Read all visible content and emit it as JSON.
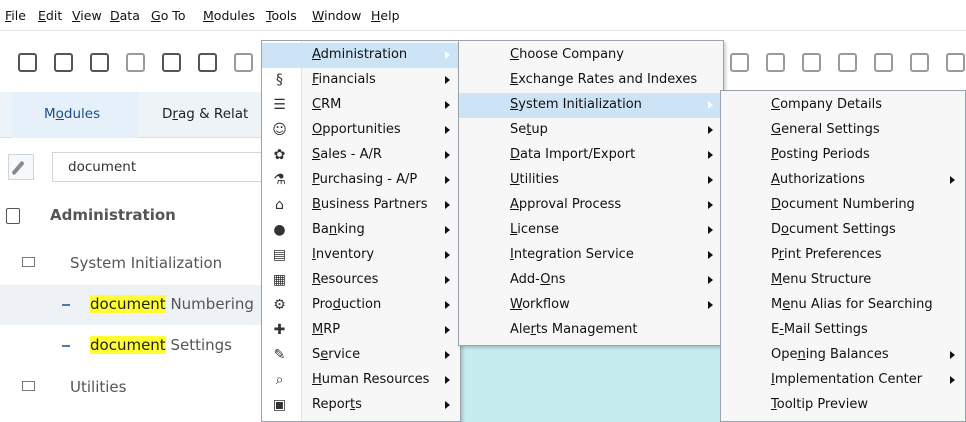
{
  "menubar": {
    "items": [
      {
        "pre": "",
        "u": "F",
        "post": "ile"
      },
      {
        "pre": "",
        "u": "E",
        "post": "dit"
      },
      {
        "pre": "",
        "u": "V",
        "post": "iew"
      },
      {
        "pre": "",
        "u": "D",
        "post": "ata"
      },
      {
        "pre": "",
        "u": "G",
        "post": "o To"
      },
      {
        "pre": "",
        "u": "M",
        "post": "odules"
      },
      {
        "pre": "",
        "u": "T",
        "post": "ools"
      },
      {
        "pre": "",
        "u": "W",
        "post": "indow"
      },
      {
        "pre": "",
        "u": "H",
        "post": "elp"
      }
    ]
  },
  "left_tabs": {
    "modules": {
      "pre": "M",
      "u": "o",
      "post": "dules"
    },
    "drag": {
      "pre": "D",
      "u": "r",
      "post": "ag & Relat"
    }
  },
  "search": {
    "value": "document"
  },
  "tree": {
    "administration": "Administration",
    "system_initialization": "System Initialization",
    "doc_numbering_match": "document",
    "doc_numbering_rest": " Numbering",
    "doc_settings_match": "document",
    "doc_settings_rest": " Settings",
    "utilities": "Utilities"
  },
  "modules_menu": [
    {
      "pre": "",
      "u": "A",
      "post": "dministration",
      "icon": "administration-icon",
      "selected": true
    },
    {
      "pre": "",
      "u": "F",
      "post": "inancials",
      "icon": "financials-icon"
    },
    {
      "pre": "",
      "u": "C",
      "post": "RM",
      "icon": "crm-icon"
    },
    {
      "pre": "",
      "u": "O",
      "post": "pportunities",
      "icon": "opportunities-icon"
    },
    {
      "pre": "",
      "u": "S",
      "post": "ales - A/R",
      "icon": "sales-icon"
    },
    {
      "pre": "",
      "u": "P",
      "post": "urchasing - A/P",
      "icon": "purchasing-icon"
    },
    {
      "pre": "",
      "u": "B",
      "post": "usiness Partners",
      "icon": "business-partners-icon"
    },
    {
      "pre": "Ba",
      "u": "n",
      "post": "king",
      "icon": "banking-icon"
    },
    {
      "pre": "",
      "u": "I",
      "post": "nventory",
      "icon": "inventory-icon"
    },
    {
      "pre": "",
      "u": "R",
      "post": "esources",
      "icon": "resources-icon"
    },
    {
      "pre": "Pro",
      "u": "d",
      "post": "uction",
      "icon": "production-icon"
    },
    {
      "pre": "",
      "u": "M",
      "post": "RP",
      "icon": "mrp-icon"
    },
    {
      "pre": "S",
      "u": "e",
      "post": "rvice",
      "icon": "service-icon"
    },
    {
      "pre": "",
      "u": "H",
      "post": "uman Resources",
      "icon": "human-resources-icon"
    },
    {
      "pre": "Repor",
      "u": "t",
      "post": "s",
      "icon": "reports-icon"
    }
  ],
  "admin_menu": [
    {
      "pre": "",
      "u": "C",
      "post": "hoose Company",
      "arrow": false
    },
    {
      "pre": "",
      "u": "E",
      "post": "xchange Rates and Indexes",
      "arrow": false
    },
    {
      "pre": "",
      "u": "S",
      "post": "ystem Initialization",
      "arrow": true,
      "selected": true
    },
    {
      "pre": "Se",
      "u": "t",
      "post": "up",
      "arrow": true
    },
    {
      "pre": "",
      "u": "D",
      "post": "ata Import/Export",
      "arrow": true
    },
    {
      "pre": "",
      "u": "U",
      "post": "tilities",
      "arrow": true
    },
    {
      "pre": "",
      "u": "A",
      "post": "pproval Process",
      "arrow": true
    },
    {
      "pre": "",
      "u": "L",
      "post": "icense",
      "arrow": true
    },
    {
      "pre": "",
      "u": "I",
      "post": "ntegration Service",
      "arrow": true
    },
    {
      "pre": "Add-",
      "u": "O",
      "post": "ns",
      "arrow": true
    },
    {
      "pre": "",
      "u": "W",
      "post": "orkflow",
      "arrow": true
    },
    {
      "pre": "Ale",
      "u": "r",
      "post": "ts Management",
      "arrow": false
    }
  ],
  "sysinit_menu": [
    {
      "pre": "",
      "u": "C",
      "post": "ompany Details",
      "arrow": false
    },
    {
      "pre": "",
      "u": "G",
      "post": "eneral Settings",
      "arrow": false
    },
    {
      "pre": "",
      "u": "P",
      "post": "osting Periods",
      "arrow": false
    },
    {
      "pre": "",
      "u": "A",
      "post": "uthorizations",
      "arrow": true
    },
    {
      "pre": "",
      "u": "D",
      "post": "ocument Numbering",
      "arrow": false
    },
    {
      "pre": "D",
      "u": "o",
      "post": "cument Settings",
      "arrow": false
    },
    {
      "pre": "P",
      "u": "r",
      "post": "int Preferences",
      "arrow": false
    },
    {
      "pre": "",
      "u": "M",
      "post": "enu Structure",
      "arrow": false
    },
    {
      "pre": "M",
      "u": "e",
      "post": "nu Alias for Searching",
      "arrow": false
    },
    {
      "pre": "E",
      "u": "-",
      "post": "Mail Settings",
      "arrow": false
    },
    {
      "pre": "Ope",
      "u": "n",
      "post": "ing Balances",
      "arrow": true
    },
    {
      "pre": "",
      "u": "I",
      "post": "mplementation Center",
      "arrow": true
    },
    {
      "pre": "",
      "u": "T",
      "post": "ooltip Preview",
      "arrow": false
    }
  ],
  "colors": {
    "selected": "#cde4f7",
    "highlight": "#ffff33",
    "accent": "#1a4f8a"
  }
}
